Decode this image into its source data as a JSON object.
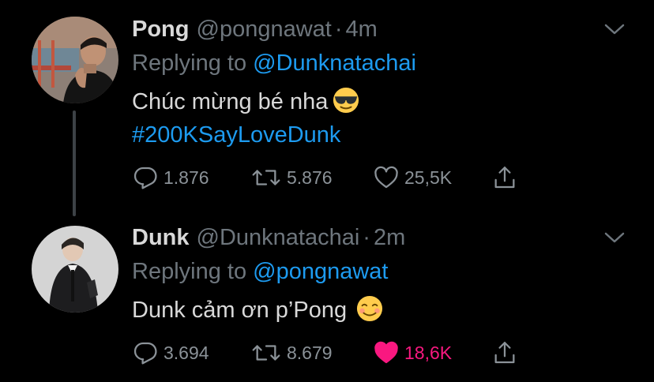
{
  "tweets": [
    {
      "name": "Pong",
      "handle": "@pongnawat",
      "separator": "·",
      "time": "4m",
      "replying_prefix": "Replying to",
      "replying_to": "@Dunknatachai",
      "text": "Chúc mừng bé nha",
      "emoji": "smiling-face-with-sunglasses",
      "hashtag": "#200KSayLoveDunk",
      "replies": "1.876",
      "retweets": "5.876",
      "likes": "25,5K",
      "liked": false
    },
    {
      "name": "Dunk",
      "handle": "@Dunknatachai",
      "separator": "·",
      "time": "2m",
      "replying_prefix": "Replying to",
      "replying_to": "@pongnawat",
      "text": "Dunk cảm ơn p’Pong",
      "emoji": "smiling-face",
      "replies": "3.694",
      "retweets": "8.679",
      "likes": "18,6K",
      "liked": true
    }
  ],
  "colors": {
    "background": "#000000",
    "text": "#d9d9d9",
    "muted": "#6e767d",
    "link": "#1d9bf0",
    "like_active": "#f91880",
    "thread_line": "#3d4246"
  }
}
